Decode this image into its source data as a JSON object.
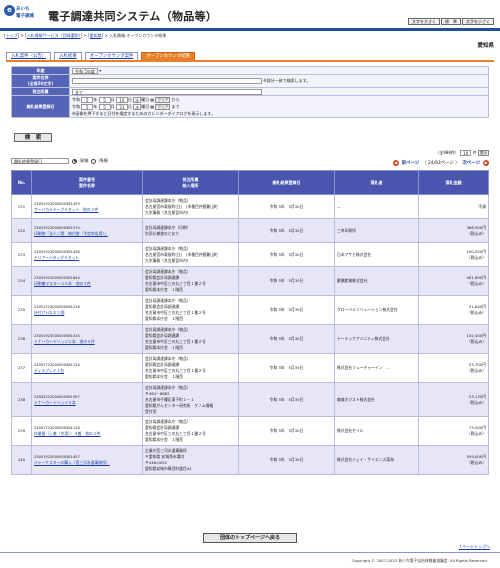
{
  "header": {
    "logo_mark": "e",
    "logo_line1": "あいち",
    "logo_line2": "電子調達",
    "title": "電子調達共同システム（物品等）",
    "size_buttons": [
      "文字を大きく",
      "標　準",
      "文字を小さく"
    ]
  },
  "breadcrumb": {
    "top": "トップ",
    "sep1": " > ",
    "service": "入札情報サービス（団体選択）",
    "sep2": " > ",
    "pref": "愛知県",
    "current": " > 入札情報-オープンカウンタ結果"
  },
  "prefecture": "愛知県",
  "tabs": [
    {
      "label": "入札案件（公告）",
      "active": false
    },
    {
      "label": "入札結果",
      "active": false
    },
    {
      "label": "オープンカウンタ案件",
      "active": false
    },
    {
      "label": "オープンカウンタ結果",
      "active": true
    }
  ],
  "form": {
    "year_label": "年度",
    "year_value": "令和 5年度",
    "name_label": "案件名称",
    "name_sub": "(全角50文字)",
    "name_hint": "※部分一致で検索します。",
    "dept_label": "発注所属",
    "dept_value": "全て",
    "date_label": "開札結果登録日",
    "era": "令和",
    "from": {
      "y": "5",
      "m": "5",
      "d": "10",
      "weekday": "水",
      "suffix": "から"
    },
    "to": {
      "y": "5",
      "m": "5",
      "d": "31",
      "weekday": "水",
      "suffix": "まで"
    },
    "year_unit": "年",
    "month_unit": "月",
    "day_unit": "日",
    "weekday_unit": "曜日",
    "clear_label": "クリア",
    "cal_note": "※画像を押下すると日付を指定するためのカレンダーダイアログを表示します。",
    "search_label": "検　索"
  },
  "list_controls": {
    "sort_value": "開札結果登録日",
    "asc_label": "昇順",
    "desc_label": "降順",
    "total": "（全988件）",
    "per_page": "10",
    "per_page_unit": "件",
    "show_label": "表示",
    "prev_label": "前ページ",
    "page_info": "（ 24/93ページ ）",
    "next_label": "次ページ"
  },
  "table": {
    "headers": {
      "no": "No.",
      "case_line1": "案件番号",
      "case_line2": "案件名称",
      "dept_line1": "発注所属",
      "dept_line2": "納入場所",
      "date": "開札結果登録日",
      "winner": "落札者",
      "amount": "落札金額"
    },
    "rows": [
      {
        "no": "231",
        "case_no": "23051923000000581459",
        "name": "サージカルテープ３セット　他の３件",
        "dept": [
          "会計局調達課本庁（物品）",
          "名古屋宮市東桜町(日)　(市番目井郡兼山町",
          "大学事務（名古屋宮市内）"
        ],
        "date": "令和 5年　5月30日",
        "winner": "—",
        "amount": "不調",
        "tax": ""
      },
      {
        "no": "232",
        "case_no": "23051923000000581574",
        "name": "印刷物「法人二税　納付書（予定申告用）」",
        "dept": [
          "会計局調達課本庁（印刷）",
          "別添仕様書のとおり"
        ],
        "date": "令和 5年　5月30日",
        "winner": "三幸印刷所",
        "amount": "368,500円",
        "tax": "（税込み）"
      },
      {
        "no": "233",
        "case_no": "23051923000000581458",
        "name": "トリアージタッグ５セット",
        "dept": [
          "会計局調達課本庁（物品）",
          "名古屋宮市東桜町(日)　(市番目井郡兼山町",
          "大学事務（名古屋宮市内）"
        ],
        "date": "令和 5年　5月30日",
        "winner": "日本アサヒ株式会社",
        "amount": "190,500円",
        "tax": "（税込み）"
      },
      {
        "no": "234",
        "case_no": "23051923000000581644",
        "name": "印刷機マスター３０本　他の２件",
        "dept": [
          "会計局調達課本庁（物品）",
          "愛知県会計局調達課",
          "名古屋市中区三の丸三丁目１番２号",
          "愛知県本庁舎　１階西"
        ],
        "date": "令和 5年　5月30日",
        "winner": "慶瀬産業株式会社",
        "amount": "461,890円",
        "tax": "（税込み）"
      },
      {
        "no": "235",
        "case_no": "23051723000000581226",
        "name": "外付けＨＤＤ２個",
        "dept": [
          "会計局調達課本庁（物品）",
          "愛知県会計局調達課",
          "名古屋市中区三の丸三丁目１番２号",
          "愛知県本庁舎　１階西"
        ],
        "date": "令和 5年　5月30日",
        "winner": "グローバルソリューション株式会社",
        "amount": "31,840円",
        "tax": "（税込み）"
      },
      {
        "no": "236",
        "case_no": "23051923000000581535",
        "name": "トナーカートリッジ２本　他の４件",
        "dept": [
          "会計局調達課本庁（物品）",
          "愛知県会計局調達課",
          "名古屋市中区三の丸三丁目１番２号",
          "愛知県本庁舎　１階西"
        ],
        "date": "令和 5年　5月30日",
        "winner": "トーテックアメニティ株式会社",
        "amount": "102,400円",
        "tax": "（税込み）"
      },
      {
        "no": "237",
        "case_no": "23051723000000581124",
        "name": "ディスプレイ３台",
        "dept": [
          "会計局調達課本庁（物品）",
          "愛知県会計局調達課",
          "名古屋市中区三の丸三丁目１番２号",
          "愛知県本庁舎　１階西"
        ],
        "date": "令和 5年　5月30日",
        "winner": "株式会社フューチャーイン　…",
        "amount": "53,700円",
        "tax": "（税込み）"
      },
      {
        "no": "238",
        "case_no": "23052223000000581907",
        "name": "トナーカートリッジ３本",
        "dept": [
          "会計局調達課本庁（物品）",
          "〒464－8682",
          "名古屋市千種区東子町１－１",
          "愛知県がんセンター研究所　ゲノム情報",
          "受付窓"
        ],
        "date": "令和 5年　5月30日",
        "winner": "森城ネクスト株式会社",
        "amount": "53,130円",
        "tax": "（税込み）"
      },
      {
        "no": "239",
        "case_no": "23051723000000581128",
        "name": "作業服（上着（冬用））４着　他の３件",
        "dept": [
          "会計局調達課本庁（物品）",
          "愛知県会計局調達課",
          "名古屋市中区三の丸三丁目１番２号",
          "愛知県本庁舎　１階西"
        ],
        "date": "令和 5年　5月30日",
        "winner": "株式会社セイル",
        "amount": "73,000円",
        "tax": "（税込み）"
      },
      {
        "no": "240",
        "case_no": "23051923000000581457",
        "name": "ジャーケスターの購入（西三河水道事務所）",
        "dept": [
          "企業庁西三河水道事務所",
          "〒愛知県 安城浄水場内",
          "〒446-0052",
          "愛知県安城市篠目町道目44"
        ],
        "date": "令和 5年　5月30日",
        "winner": "株式会社ジェイ・サイエンス東海",
        "amount": "509,000円",
        "tax": "（税込み）"
      }
    ]
  },
  "bottom_button": "団体のトップページへ戻る",
  "page_top": "↑ページトップへ",
  "copyright": "Copyright © 2007-2023 あいち電子自治体推進協議会. All Rights Reserved."
}
